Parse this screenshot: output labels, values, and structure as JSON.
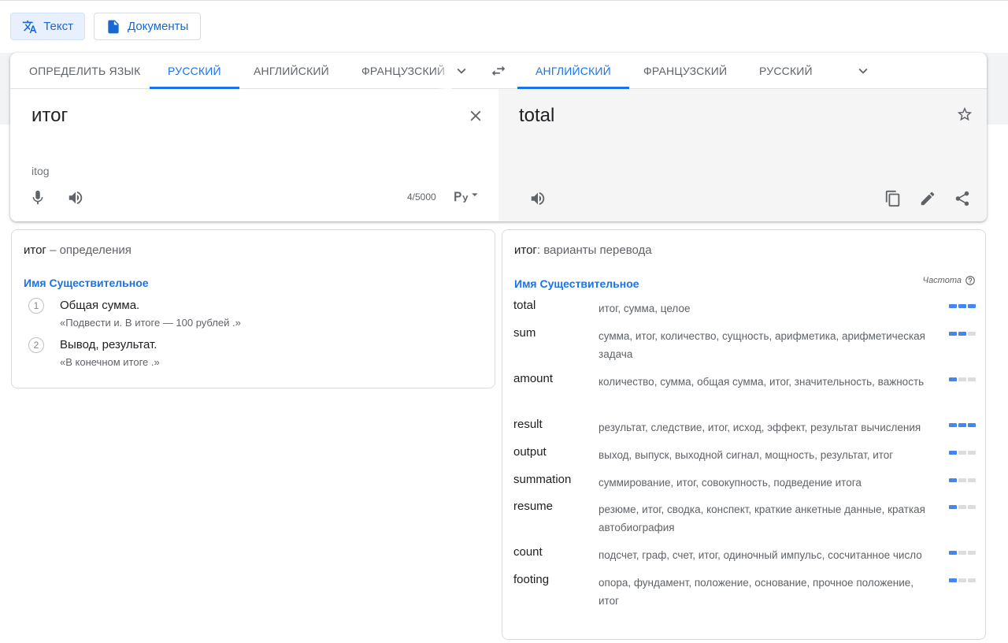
{
  "modes": {
    "text_label": "Текст",
    "documents_label": "Документы"
  },
  "source_langs": [
    "ОПРЕДЕЛИТЬ ЯЗЫК",
    "РУССКИЙ",
    "АНГЛИЙСКИЙ",
    "ФРАНЦУЗСКИЙ"
  ],
  "target_langs": [
    "АНГЛИЙСКИЙ",
    "ФРАНЦУЗСКИЙ",
    "РУССКИЙ"
  ],
  "source": {
    "text": "итог",
    "transliteration": "itog",
    "char_count": "4/5000"
  },
  "target": {
    "text": "total"
  },
  "definitions": {
    "word": "итог",
    "title_suffix": " – определения",
    "pos": "Имя Существительное",
    "items": [
      {
        "num": "1",
        "text": "Общая сумма.",
        "example": "«Подвести и. В итоге — 100 рублей .»"
      },
      {
        "num": "2",
        "text": "Вывод, результат.",
        "example": "«В конечном итоге .»"
      }
    ]
  },
  "translations": {
    "word": "итог",
    "title_suffix": ": варианты перевода",
    "pos": "Имя Существительное",
    "freq_label": "Частота",
    "rows": [
      {
        "word": "total",
        "synonyms": "итог, сумма, целое",
        "freq": 3
      },
      {
        "word": "sum",
        "synonyms": "сумма, итог, количество, сущность, арифметика, арифметическая задача",
        "freq": 2
      },
      {
        "word": "amount",
        "synonyms": "количество, сумма, общая сумма, итог, значительность, важность",
        "freq": 1
      },
      {
        "word": "result",
        "synonyms": "результат, следствие, итог, исход, эффект, результат вычисления",
        "freq": 3
      },
      {
        "word": "output",
        "synonyms": "выход, выпуск, выходной сигнал, мощность, результат, итог",
        "freq": 1
      },
      {
        "word": "summation",
        "synonyms": "суммирование, итог, совокупность, подведение итога",
        "freq": 1
      },
      {
        "word": "resume",
        "synonyms": "резюме, итог, сводка, конспект, краткие анкетные данные, краткая автобиография",
        "freq": 1
      },
      {
        "word": "count",
        "synonyms": "подсчет, граф, счет, итог, одиночный импульс, сосчитанное число",
        "freq": 1
      },
      {
        "word": "footing",
        "synonyms": "опора, фундамент, положение, основание, прочное положение, итог",
        "freq": 1
      }
    ]
  },
  "colors": {
    "accent": "#1a73e8",
    "freq_on": "#4285f4",
    "freq_off": "#dadce0"
  }
}
